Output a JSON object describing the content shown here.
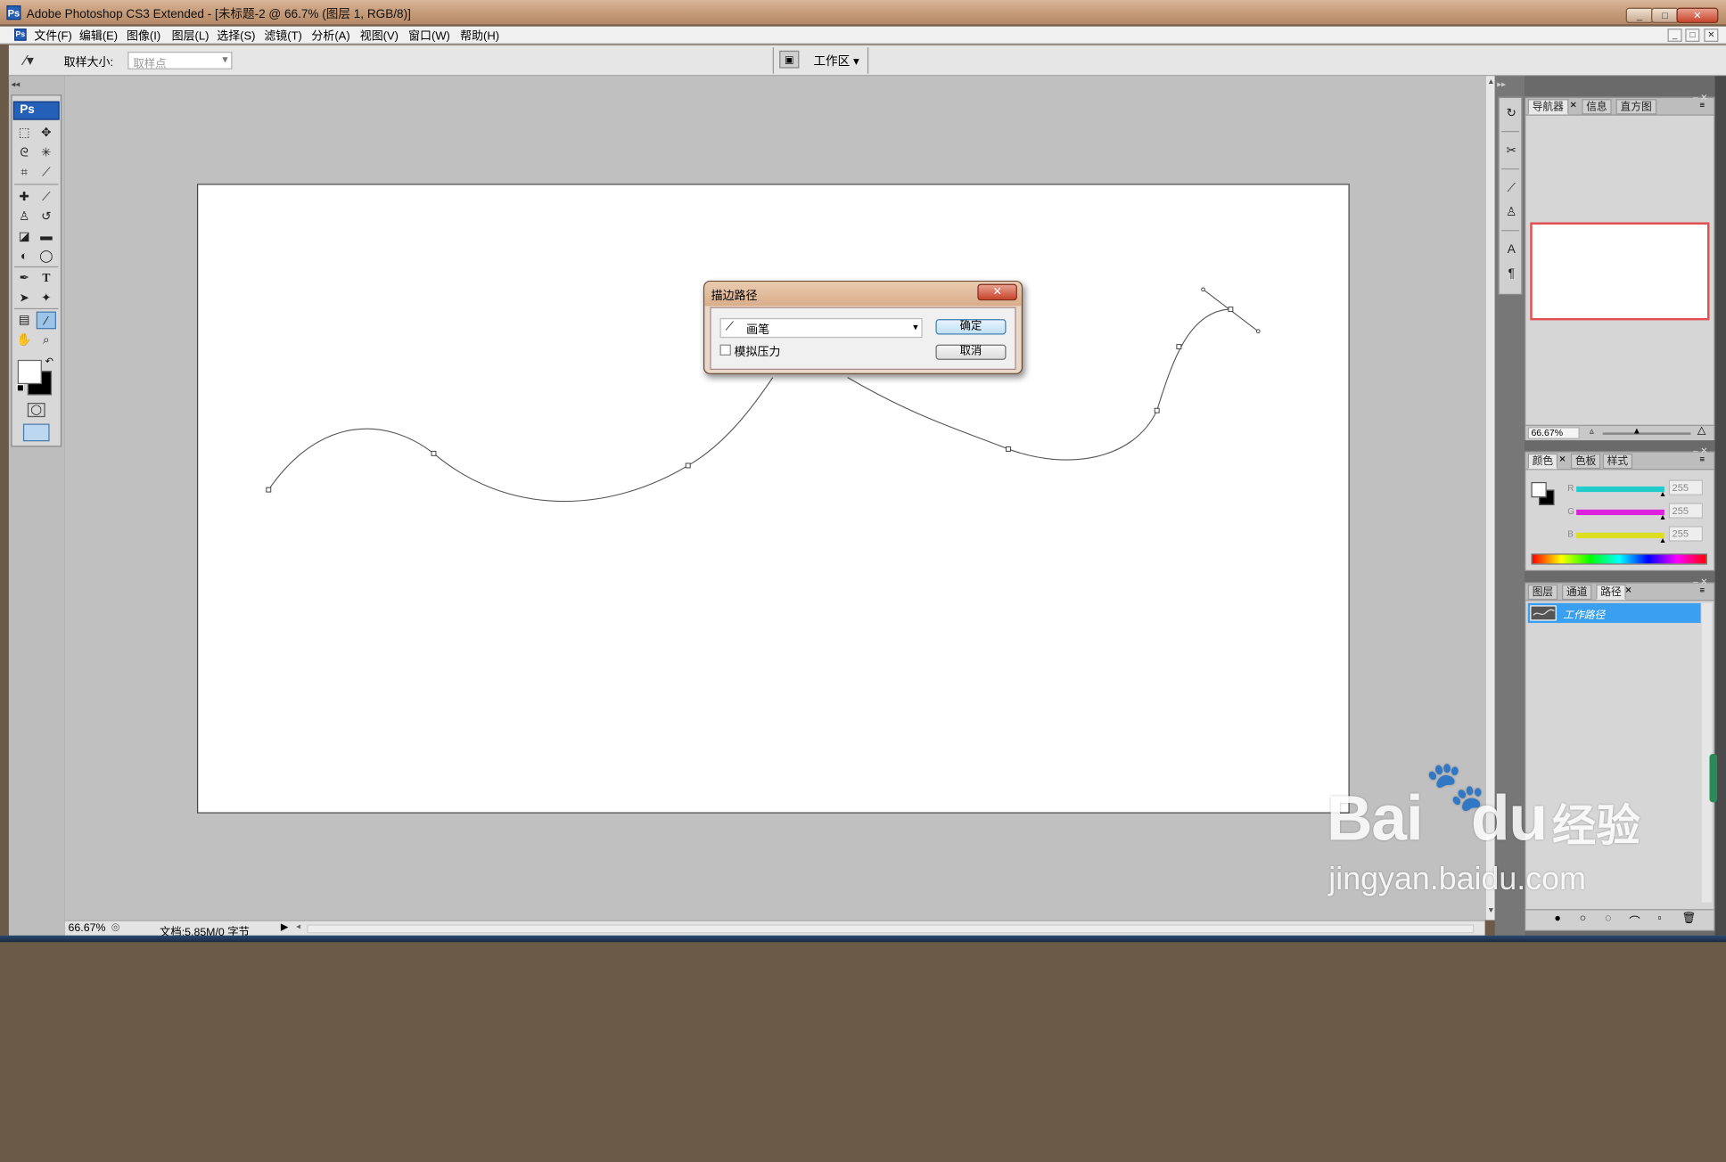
{
  "app": {
    "title": "Adobe Photoshop CS3 Extended - [未标题-2 @ 66.7% (图层 1, RGB/8)]",
    "ps_logo": "Ps"
  },
  "window_controls": {
    "minimize": "_",
    "maximize": "□",
    "close": "✕"
  },
  "menu": [
    "文件(F)",
    "编辑(E)",
    "图像(I)",
    "图层(L)",
    "选择(S)",
    "滤镜(T)",
    "分析(A)",
    "视图(V)",
    "窗口(W)",
    "帮助(H)"
  ],
  "options_bar": {
    "sample_size_label": "取样大小:",
    "sample_size_value": "取样点",
    "workspace_label": "工作区"
  },
  "toolbox": {
    "header": "Ps",
    "tools": [
      "rectangular-marquee-icon",
      "move-icon",
      "lasso-icon",
      "magic-wand-icon",
      "crop-icon",
      "slice-icon",
      "healing-brush-icon",
      "brush-icon",
      "clone-stamp-icon",
      "history-brush-icon",
      "eraser-icon",
      "gradient-icon",
      "blur-icon",
      "dodge-icon",
      "pen-icon",
      "type-icon",
      "path-selection-icon",
      "custom-shape-icon",
      "notes-icon",
      "eyedropper-icon",
      "hand-icon",
      "zoom-icon"
    ],
    "text_tool_glyph": "T"
  },
  "dialog": {
    "title": "描边路径",
    "close_label": "✕",
    "tool_select_value": "画笔",
    "simulate_pressure_label": "模拟压力",
    "simulate_pressure_checked": false,
    "ok_label": "确定",
    "cancel_label": "取消"
  },
  "navigator_panel": {
    "tabs": [
      "导航器",
      "信息",
      "直方图"
    ],
    "active_tab": "导航器",
    "zoom_value": "66.67%"
  },
  "color_panel": {
    "tabs": [
      "颜色",
      "色板",
      "样式"
    ],
    "active_tab": "颜色",
    "channels": [
      {
        "label": "R",
        "value": "255",
        "color": "#22cccc"
      },
      {
        "label": "G",
        "value": "255",
        "color": "#dd22dd"
      },
      {
        "label": "B",
        "value": "255",
        "color": "#dddd22"
      }
    ]
  },
  "paths_panel": {
    "tabs": [
      "图层",
      "通道",
      "路径"
    ],
    "active_tab": "路径",
    "items": [
      {
        "name": "工作路径",
        "selected": true
      }
    ]
  },
  "status_bar": {
    "zoom": "66.67%",
    "doc_info": "文档:5.85M/0 字节"
  },
  "watermark": {
    "brand": "Bai",
    "brand2": "du",
    "site_cn": "经验",
    "url": "jingyan.baidu.com"
  },
  "colors": {
    "accent": "#3399ff",
    "navigator_frame": "#e05050",
    "selection_row": "#3a9fef"
  }
}
